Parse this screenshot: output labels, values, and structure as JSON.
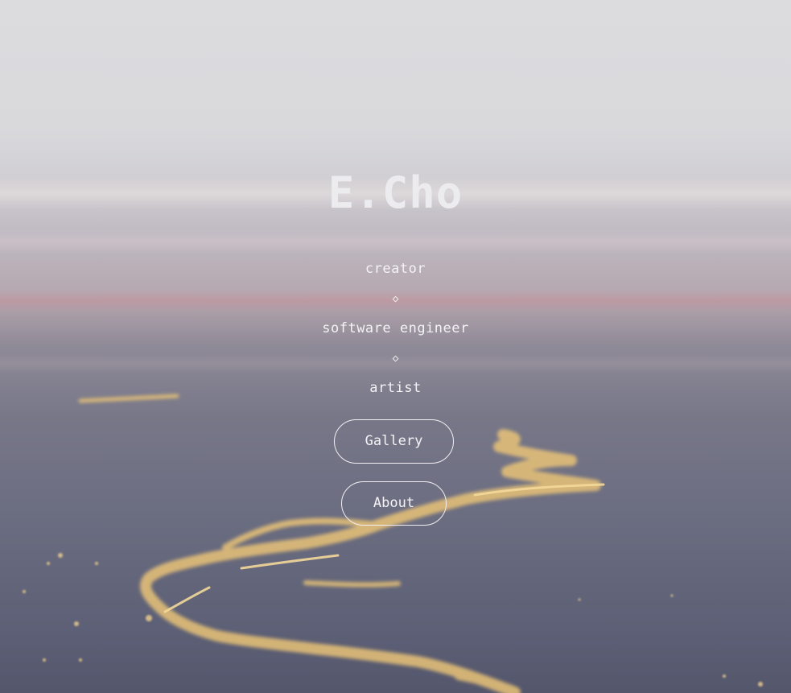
{
  "hero": {
    "title": "E.Cho",
    "roles": [
      "creator",
      "software engineer",
      "artist"
    ],
    "separator": "◇"
  },
  "nav": {
    "gallery_label": "Gallery",
    "about_label": "About"
  },
  "background": {
    "description_colors": {
      "sky_top": "#dcdcdf",
      "horizon_pink": "#b5a6ae",
      "land_dark": "#54566c",
      "river_glow": "#e8c277"
    }
  }
}
